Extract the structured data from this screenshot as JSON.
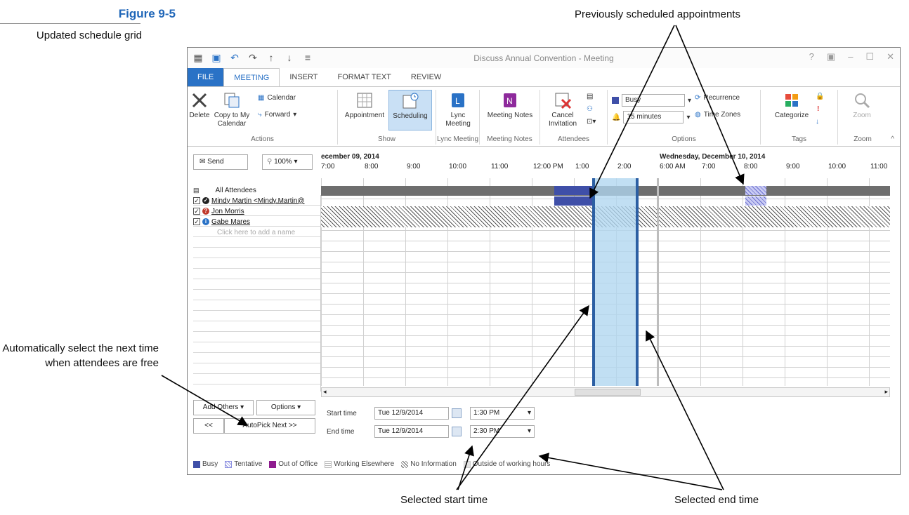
{
  "figure": {
    "number": "Figure 9-5",
    "caption": "Updated schedule grid"
  },
  "callouts": {
    "previous": "Previously scheduled appointments",
    "autopick": "Automatically select the next time when attendees are free",
    "start": "Selected start time",
    "end": "Selected end time"
  },
  "window": {
    "title": "Discuss Annual Convention - Meeting",
    "controls": [
      "?",
      "▣",
      "–",
      "☐",
      "✕"
    ]
  },
  "tabs": [
    "FILE",
    "MEETING",
    "INSERT",
    "FORMAT TEXT",
    "REVIEW"
  ],
  "active_tab": "MEETING",
  "ribbon": {
    "actions": {
      "delete": "Delete",
      "copy": "Copy to My Calendar",
      "calendar": "Calendar",
      "forward": "Forward",
      "group": "Actions"
    },
    "show": {
      "appointment": "Appointment",
      "scheduling": "Scheduling",
      "group": "Show"
    },
    "lync": {
      "label": "Lync Meeting",
      "group": "Lync Meeting"
    },
    "notes": {
      "label": "Meeting Notes",
      "group": "Meeting Notes"
    },
    "attendees": {
      "cancel": "Cancel Invitation",
      "group": "Attendees"
    },
    "options": {
      "busy": "Busy",
      "reminder": "15 minutes",
      "recurrence": "Recurrence",
      "timezones": "Time Zones",
      "group": "Options"
    },
    "tags": {
      "categorize": "Categorize",
      "group": "Tags"
    },
    "zoom": {
      "label": "Zoom",
      "group": "Zoom"
    }
  },
  "toolbar": {
    "send": "Send",
    "zoom": "100%"
  },
  "attendees_header": "All Attendees",
  "attendees": [
    {
      "name": "Mindy Martin <Mindy.Martin@",
      "status_color": "#222222",
      "status_glyph": "✓"
    },
    {
      "name": "Jon Morris",
      "status_color": "#c0392b",
      "status_glyph": "?"
    },
    {
      "name": "Gabe Mares",
      "status_color": "#2a72c6",
      "status_glyph": "i"
    }
  ],
  "add_name_placeholder": "Click here to add a name",
  "grid": {
    "day1": "ecember 09, 2014",
    "day2": "Wednesday, December 10, 2014",
    "day1_times": [
      "7:00",
      "8:00",
      "9:00",
      "10:00",
      "11:00",
      "12:00 PM",
      "1:00",
      "2:00"
    ],
    "day2_times": [
      "6:00 AM",
      "7:00",
      "8:00",
      "9:00",
      "10:00",
      "11:00"
    ]
  },
  "bottom": {
    "add_others": "Add Others",
    "options": "Options",
    "prev": "<<",
    "autopick": "AutoPick Next >>",
    "start_label": "Start time",
    "end_label": "End time",
    "start_date": "Tue 12/9/2014",
    "start_time": "1:30 PM",
    "end_date": "Tue 12/9/2014",
    "end_time": "2:30 PM"
  },
  "legend": [
    {
      "label": "Busy",
      "color": "#3f4fa8"
    },
    {
      "label": "Tentative",
      "color": "#8a8ee0"
    },
    {
      "label": "Out of Office",
      "color": "#8e1b8e"
    },
    {
      "label": "Working Elsewhere",
      "color": "#cfcfcf"
    },
    {
      "label": "No Information",
      "color": "#555555"
    },
    {
      "label": "Outside of working hours",
      "color": "#e3e3e3"
    }
  ]
}
